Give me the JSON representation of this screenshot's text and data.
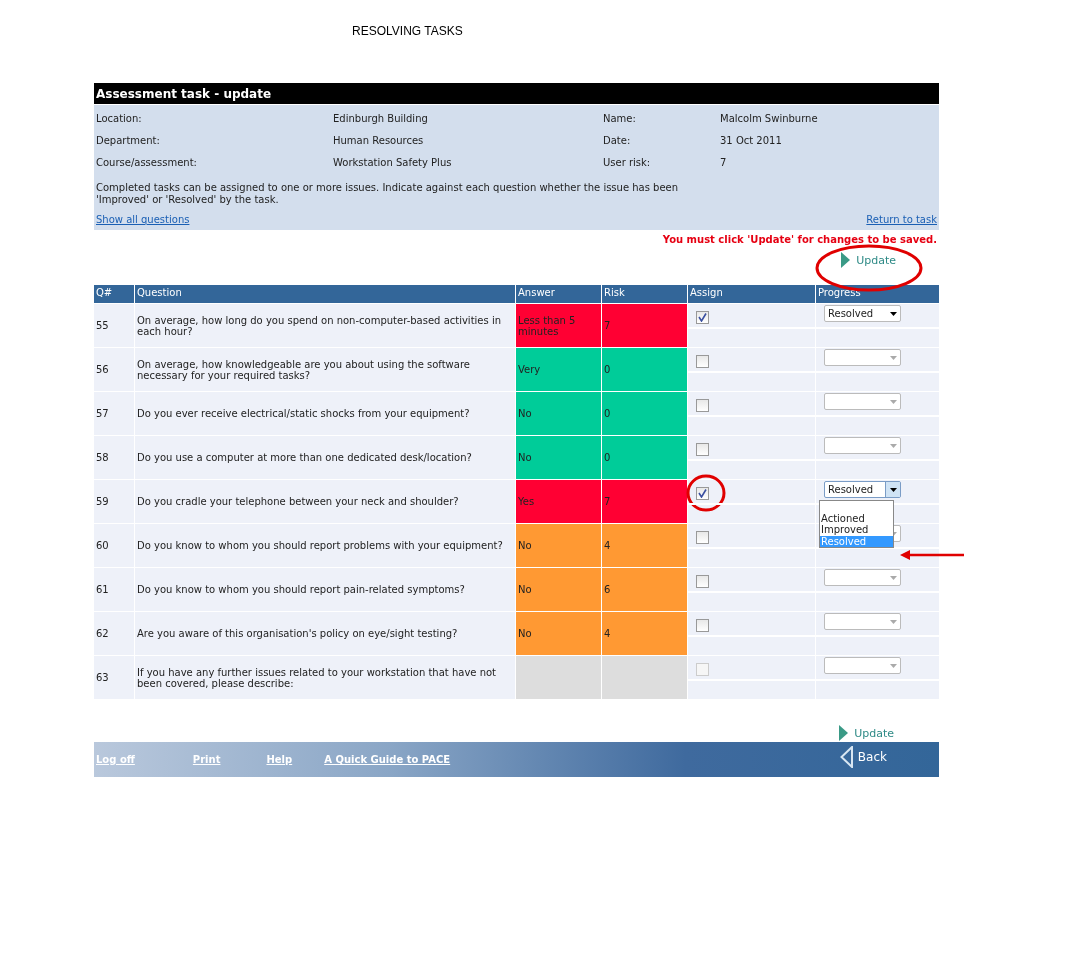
{
  "slide_title": "RESOLVING TASKS",
  "panel": {
    "title": "Assessment task - update",
    "fields": [
      {
        "label": "Location:",
        "value": "Edinburgh Building"
      },
      {
        "label": "Name:",
        "value": "Malcolm Swinburne"
      },
      {
        "label": "Department:",
        "value": "Human Resources"
      },
      {
        "label": "Date:",
        "value": "31 Oct 2011"
      },
      {
        "label": "Course/assessment:",
        "value": "Workstation Safety Plus"
      },
      {
        "label": "User risk:",
        "value": "7"
      }
    ],
    "note": "Completed tasks can be assigned to one or more issues. Indicate against each question whether the issue has been 'Improved' or 'Resolved' by the task.",
    "show_all_link": "Show all questions",
    "return_link": "Return to task"
  },
  "warning": "You must click 'Update' for changes to be saved.",
  "update_top": {
    "label": "Update",
    "circled": true
  },
  "table": {
    "columns": [
      "Q#",
      "Question",
      "Answer",
      "Risk",
      "Assign",
      "Progress"
    ],
    "rows": [
      {
        "q": "55",
        "question": "On average, how long do you spend on non-computer-based activities in each hour?",
        "answer": "Less than 5 minutes",
        "risk": "7",
        "color": "#ff0033",
        "assigned": true,
        "disabled": false,
        "progress": "Resolved",
        "open": false
      },
      {
        "q": "56",
        "question": "On average, how knowledgeable are you about using the software necessary for your required tasks?",
        "answer": "Very",
        "risk": "0",
        "color": "#00cc99",
        "assigned": false,
        "disabled": false,
        "open": false
      },
      {
        "q": "57",
        "question": "Do you ever receive electrical/static shocks from your equipment?",
        "answer": "No",
        "risk": "0",
        "color": "#00cc99",
        "assigned": false,
        "disabled": false,
        "open": false
      },
      {
        "q": "58",
        "question": "Do you use a computer at more than one dedicated desk/location?",
        "answer": "No",
        "risk": "0",
        "color": "#00cc99",
        "assigned": false,
        "disabled": false,
        "open": false
      },
      {
        "q": "59",
        "question": "Do you cradle your telephone between your neck and shoulder?",
        "answer": "Yes",
        "risk": "7",
        "color": "#ff0033",
        "assigned": true,
        "disabled": false,
        "circled": true,
        "progress": "Resolved",
        "open": true,
        "options": [
          {
            "label": "Actioned",
            "selected": false,
            "arrow": false
          },
          {
            "label": "Improved",
            "selected": false,
            "arrow": false
          },
          {
            "label": "Resolved",
            "selected": true,
            "arrow": true
          }
        ]
      },
      {
        "q": "60",
        "question": "Do you know to whom you should report problems with your equipment?",
        "answer": "No",
        "risk": "4",
        "color": "#ff9933",
        "assigned": false,
        "disabled": false,
        "open": false
      },
      {
        "q": "61",
        "question": "Do you know to whom you should report pain-related symptoms?",
        "answer": "No",
        "risk": "6",
        "color": "#ff9933",
        "assigned": false,
        "disabled": false,
        "open": false
      },
      {
        "q": "62",
        "question": "Are you aware of this organisation's policy on eye/sight testing?",
        "answer": "No",
        "risk": "4",
        "color": "#ff9933",
        "assigned": false,
        "disabled": false,
        "open": false
      },
      {
        "q": "63",
        "question": "If you have any further issues related to your workstation that have not been covered, please describe:",
        "color": "#dddddd",
        "assigned": false,
        "disabled": true,
        "open": false
      }
    ]
  },
  "update_bottom": {
    "label": "Update"
  },
  "footer": {
    "links": [
      "Log off",
      "Print",
      "Help",
      "A Quick Guide to PACE"
    ],
    "back": "Back"
  }
}
